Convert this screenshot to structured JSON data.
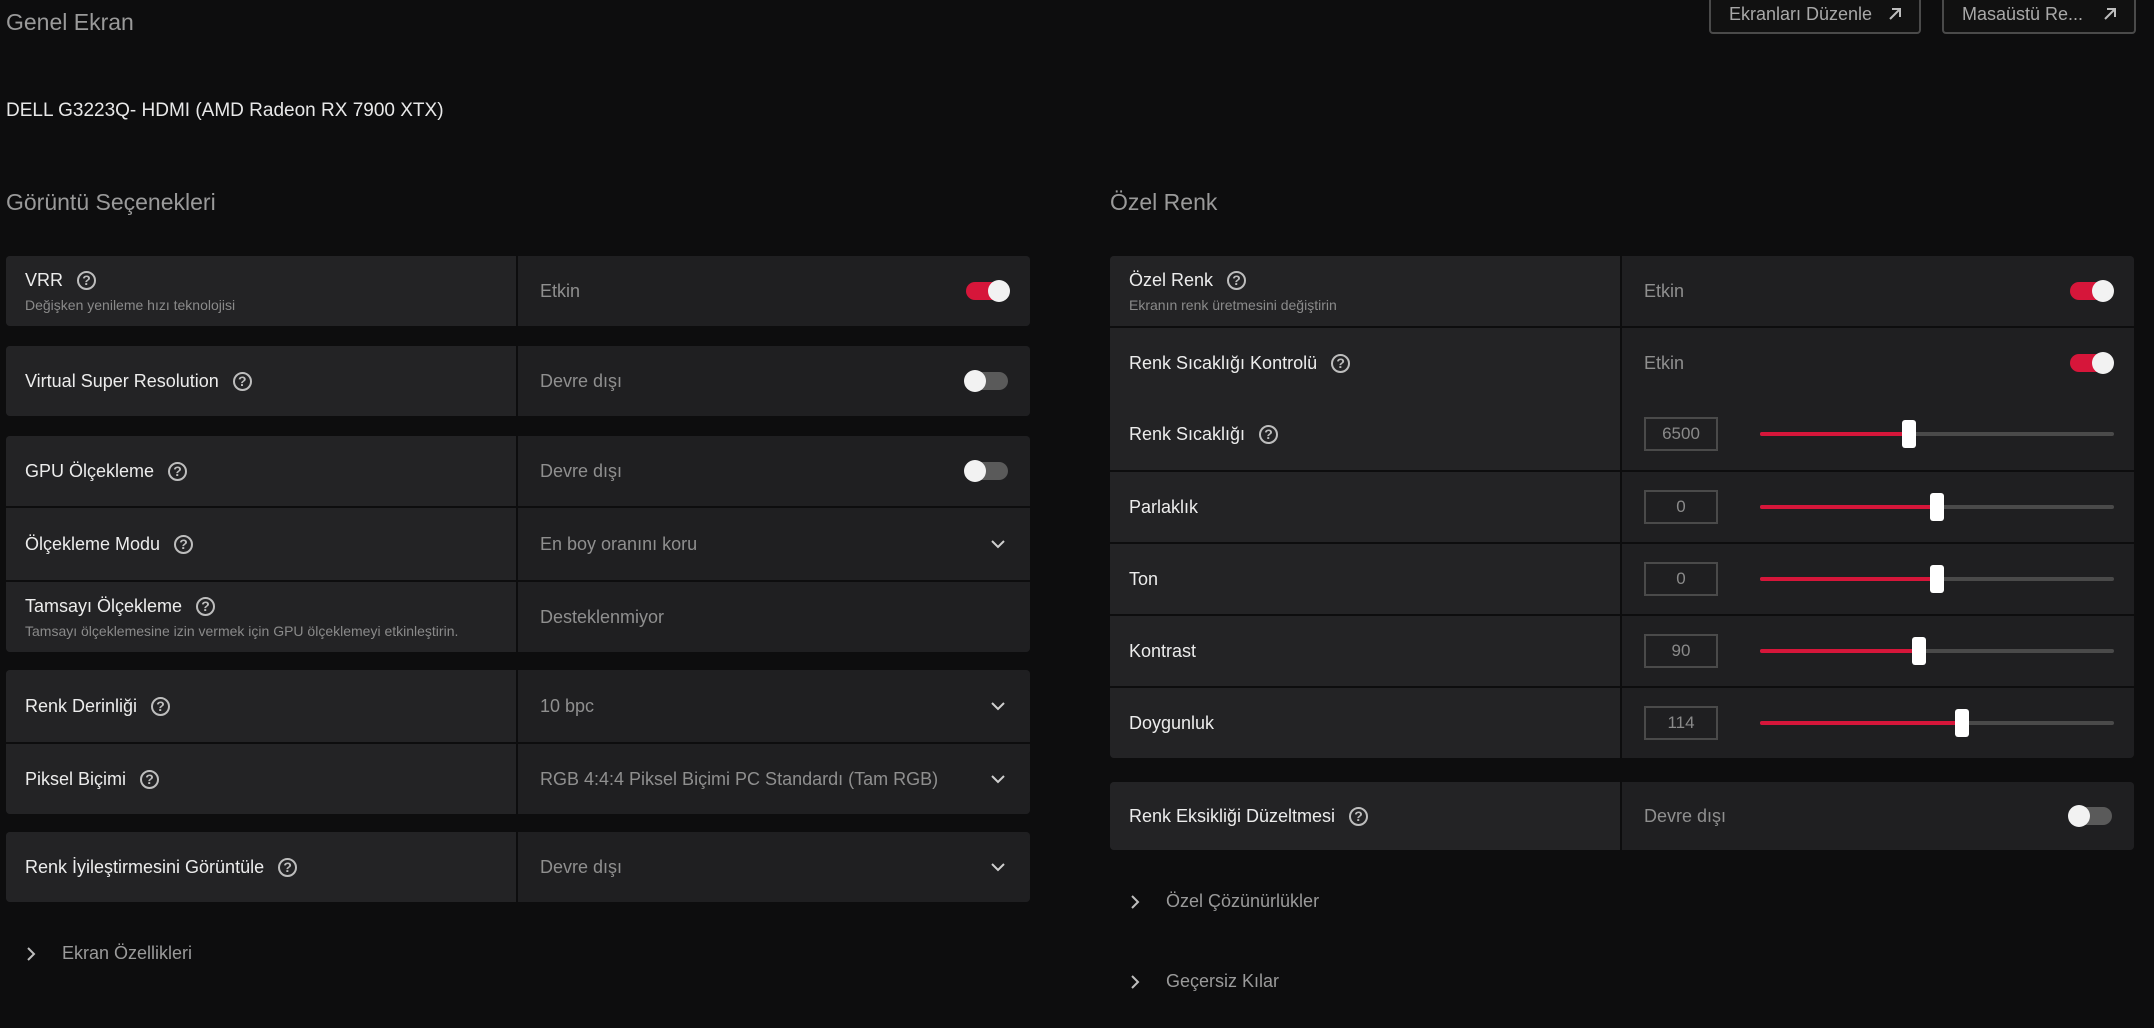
{
  "header": {
    "title": "Genel Ekran",
    "edit_screens": "Ekranları Düzenle",
    "desktop": "Masaüstü Re..."
  },
  "device": "DELL G3223Q- HDMI (AMD Radeon RX 7900 XTX)",
  "left": {
    "title": "Görüntü Seçenekleri",
    "vrr": {
      "label": "VRR",
      "sub": "Değişken yenileme hızı teknolojisi",
      "value": "Etkin",
      "on": true
    },
    "vsr": {
      "label": "Virtual Super Resolution",
      "value": "Devre dışı",
      "on": false
    },
    "gpu_scaling": {
      "label": "GPU Ölçekleme",
      "value": "Devre dışı",
      "on": false
    },
    "scaling_mode": {
      "label": "Ölçekleme Modu",
      "value": "En boy oranını koru"
    },
    "integer_scaling": {
      "label": "Tamsayı Ölçekleme",
      "sub": "Tamsayı ölçeklemesine izin vermek için GPU ölçeklemeyi etkinleştirin.",
      "value": "Desteklenmiyor"
    },
    "color_depth": {
      "label": "Renk Derinliği",
      "value": "10 bpc"
    },
    "pixel_format": {
      "label": "Piksel Biçimi",
      "value": "RGB 4:4:4 Piksel Biçimi PC Standardı (Tam RGB)"
    },
    "color_enhance": {
      "label": "Renk İyileştirmesini Görüntüle",
      "value": "Devre dışı"
    },
    "display_props": "Ekran Özellikleri"
  },
  "right": {
    "title": "Özel Renk",
    "custom_color": {
      "label": "Özel Renk",
      "sub": "Ekranın renk üretmesini değiştirin",
      "value": "Etkin",
      "on": true
    },
    "temp_control": {
      "label": "Renk Sıcaklığı Kontrolü",
      "value": "Etkin",
      "on": true
    },
    "sliders": [
      {
        "label": "Renk Sıcaklığı",
        "value": "6500",
        "level": 0.42,
        "help": true
      },
      {
        "label": "Parlaklık",
        "value": "0",
        "level": 0.5,
        "help": false
      },
      {
        "label": "Ton",
        "value": "0",
        "level": 0.5,
        "help": false
      },
      {
        "label": "Kontrast",
        "value": "90",
        "level": 0.45,
        "help": false
      },
      {
        "label": "Doygunluk",
        "value": "114",
        "level": 0.57,
        "help": false
      }
    ],
    "color_blind": {
      "label": "Renk Eksikliği Düzeltmesi",
      "value": "Devre dışı",
      "on": false
    },
    "custom_res": "Özel Çözünürlükler",
    "override": "Geçersiz Kılar"
  },
  "colors": {
    "accent": "#d6163a",
    "background": "#0d0d0e",
    "panel": "#1e1e20"
  },
  "icons": [
    "help-icon",
    "chevron-down-icon",
    "chevron-right-icon",
    "external-link-icon"
  ]
}
